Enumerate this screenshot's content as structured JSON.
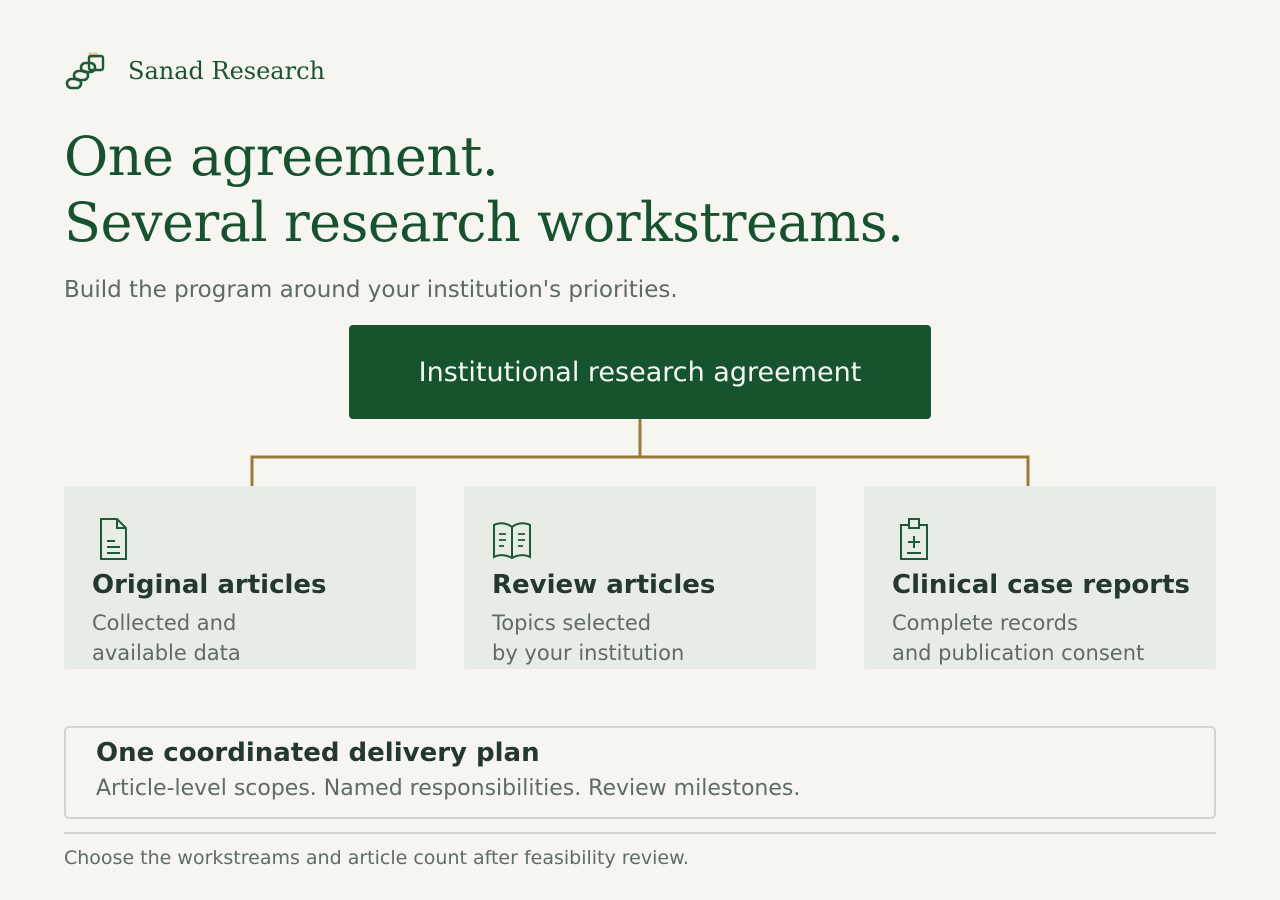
{
  "brand": {
    "name": "Sanad Research",
    "logo_icon": "linked-rings-logo-icon"
  },
  "hero": {
    "headline_line_1": "One agreement.",
    "headline_line_2": "Several research workstreams.",
    "subtitle": "Build the program around your institution's priorities."
  },
  "diagram": {
    "root": {
      "label": "Institutional research agreement"
    },
    "workstreams": [
      {
        "title": "Original articles",
        "description_line_1": "Collected and",
        "description_line_2": "available data",
        "icon": "document-icon"
      },
      {
        "title": "Review articles",
        "description_line_1": "Topics selected",
        "description_line_2": "by your institution",
        "icon": "open-book-icon"
      },
      {
        "title": "Clinical case reports",
        "description_line_1": "Complete records",
        "description_line_2": "and publication consent",
        "icon": "medical-clipboard-icon"
      }
    ]
  },
  "plan": {
    "title": "One coordinated delivery plan",
    "description": "Article-level scopes. Named responsibilities. Review milestones."
  },
  "footnote": "Choose the workstreams and article count after feasibility review.",
  "colors": {
    "background": "#f6f5f0",
    "brand_green": "#165430",
    "connector_gold": "#9b7a3e",
    "card_background": "#e7ece5"
  }
}
